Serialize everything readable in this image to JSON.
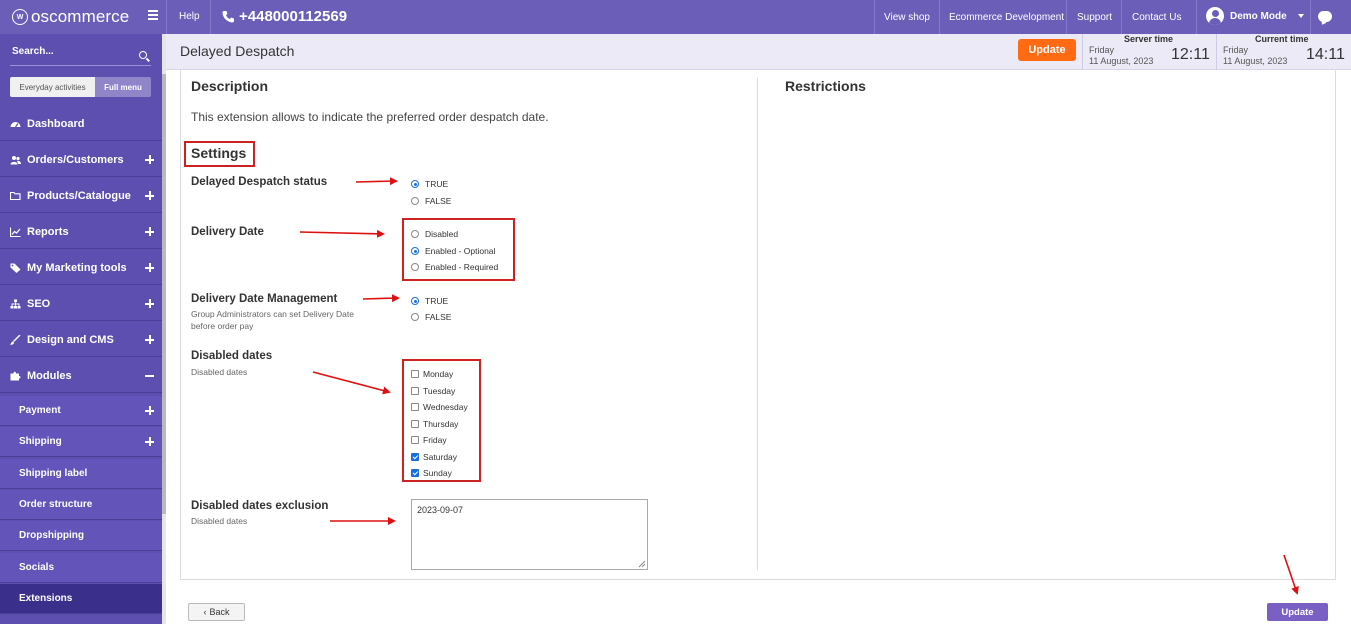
{
  "topbar": {
    "logo_text": "oscommerce",
    "help": "Help",
    "phone": "+448000112569",
    "links": [
      "View shop",
      "Ecommerce Development",
      "Support",
      "Contact Us"
    ],
    "user": "Demo Mode"
  },
  "sidebar": {
    "search_placeholder": "Search...",
    "menu_toggle": {
      "everyday": "Everyday activities",
      "full": "Full menu"
    },
    "items": [
      {
        "label": "Dashboard",
        "icon": "dashboard-icon",
        "expand": "none"
      },
      {
        "label": "Orders/Customers",
        "icon": "users-icon",
        "expand": "plus"
      },
      {
        "label": "Products/Catalogue",
        "icon": "folder-icon",
        "expand": "plus"
      },
      {
        "label": "Reports",
        "icon": "chart-line-icon",
        "expand": "plus"
      },
      {
        "label": "My Marketing tools",
        "icon": "tag-icon",
        "expand": "plus"
      },
      {
        "label": "SEO",
        "icon": "sitemap-icon",
        "expand": "plus"
      },
      {
        "label": "Design and CMS",
        "icon": "brush-icon",
        "expand": "plus"
      },
      {
        "label": "Modules",
        "icon": "puzzle-icon",
        "expand": "minus"
      }
    ],
    "sub_items": [
      {
        "label": "Payment",
        "expand": "plus"
      },
      {
        "label": "Shipping",
        "expand": "plus"
      },
      {
        "label": "Shipping label",
        "expand": "none"
      },
      {
        "label": "Order structure",
        "expand": "none"
      },
      {
        "label": "Dropshipping",
        "expand": "none"
      },
      {
        "label": "Socials",
        "expand": "none"
      },
      {
        "label": "Extensions",
        "expand": "none",
        "active": true
      }
    ]
  },
  "header": {
    "title": "Delayed Despatch",
    "update_label": "Update",
    "server_time": {
      "label": "Server time",
      "day": "Friday",
      "date": "11 August, 2023",
      "time": "12:11"
    },
    "current_time": {
      "label": "Current time",
      "day": "Friday",
      "date": "11 August, 2023",
      "time": "14:11"
    }
  },
  "main": {
    "description_title": "Description",
    "description_text": "This extension allows to indicate the preferred order despatch date.",
    "restrictions_title": "Restrictions",
    "settings_title": "Settings",
    "fields": {
      "status": {
        "label": "Delayed Despatch status",
        "options": [
          "TRUE",
          "FALSE"
        ],
        "selected": "TRUE"
      },
      "delivery_date": {
        "label": "Delivery Date",
        "options": [
          "Disabled",
          "Enabled - Optional",
          "Enabled - Required"
        ],
        "selected": "Enabled - Optional"
      },
      "management": {
        "label": "Delivery Date Management",
        "desc_line1": "Group Administrators can set Delivery Date",
        "desc_line2": "before order pay",
        "options": [
          "TRUE",
          "FALSE"
        ],
        "selected": "TRUE"
      },
      "disabled_dates": {
        "label": "Disabled dates",
        "desc": "Disabled dates",
        "days": [
          "Monday",
          "Tuesday",
          "Wednesday",
          "Thursday",
          "Friday",
          "Saturday",
          "Sunday"
        ],
        "checked": [
          "Saturday",
          "Sunday"
        ]
      },
      "exclusion": {
        "label": "Disabled dates exclusion",
        "desc": "Disabled dates",
        "value": "2023-09-07"
      }
    }
  },
  "footer": {
    "back_label": "Back",
    "update_label": "Update"
  },
  "colors": {
    "topbar": "#6a5eb8",
    "sidebar": "#5c4fb0",
    "accent_orange": "#ff6a13",
    "annotation_red": "#cc2222",
    "update_purple": "#7a5fc4"
  }
}
